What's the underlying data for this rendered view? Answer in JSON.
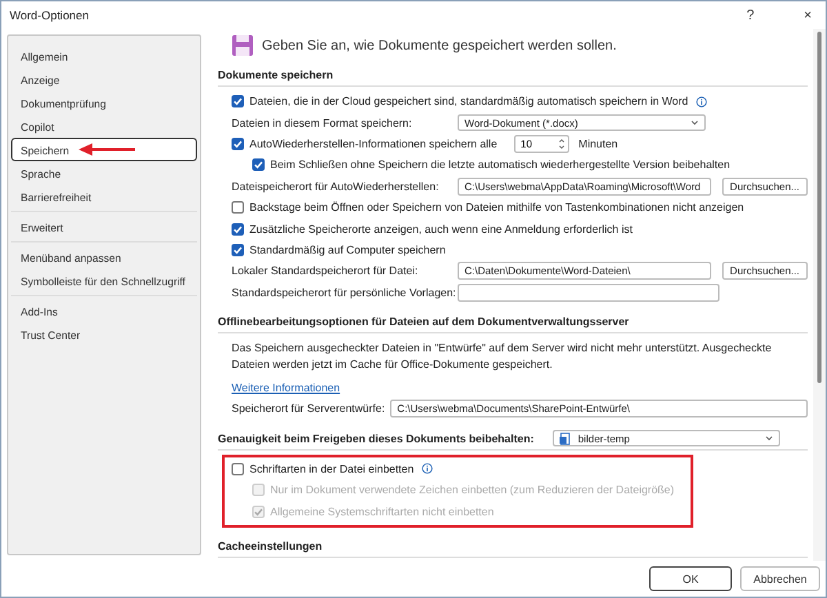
{
  "window": {
    "title": "Word-Optionen",
    "help": "?",
    "close": "×"
  },
  "sidebar": {
    "groups": [
      [
        {
          "label": "Allgemein",
          "selected": false,
          "annotated": false
        },
        {
          "label": "Anzeige",
          "selected": false,
          "annotated": false
        },
        {
          "label": "Dokumentprüfung",
          "selected": false,
          "annotated": false
        },
        {
          "label": "Copilot",
          "selected": false,
          "annotated": false
        },
        {
          "label": "Speichern",
          "selected": true,
          "annotated": true
        },
        {
          "label": "Sprache",
          "selected": false,
          "annotated": false
        },
        {
          "label": "Barrierefreiheit",
          "selected": false,
          "annotated": false
        }
      ],
      [
        {
          "label": "Erweitert",
          "selected": false,
          "annotated": false
        }
      ],
      [
        {
          "label": "Menüband anpassen",
          "selected": false,
          "annotated": false
        },
        {
          "label": "Symbolleiste für den Schnellzugriff",
          "selected": false,
          "annotated": false
        }
      ],
      [
        {
          "label": "Add-Ins",
          "selected": false,
          "annotated": false
        },
        {
          "label": "Trust Center",
          "selected": false,
          "annotated": false
        }
      ]
    ]
  },
  "content": {
    "banner": "Geben Sie an, wie Dokumente gespeichert werden sollen.",
    "sections": [
      {
        "heading": "Dokumente speichern",
        "rows": [
          {
            "kind": "checkbox",
            "label": "Dateien, die in der Cloud gespeichert sind, standardmäßig automatisch speichern in Word",
            "checked": true,
            "info": true
          },
          {
            "kind": "select",
            "label": "Dateien in diesem Format speichern:",
            "value": "Word-Dokument (*.docx)"
          },
          {
            "kind": "spin",
            "label": "AutoWiederherstellen-Informationen speichern alle",
            "checked": true,
            "value": "10",
            "unit": "Minuten",
            "children": [
              {
                "kind": "checkbox",
                "label": "Beim Schließen ohne Speichern die letzte automatisch wiederhergestellte Version beibehalten",
                "checked": true
              }
            ]
          },
          {
            "kind": "path",
            "label": "Dateispeicherort für AutoWiederherstellen:",
            "value": "C:\\Users\\webma\\AppData\\Roaming\\Microsoft\\Word",
            "button": "Durchsuchen..."
          },
          {
            "kind": "checkbox",
            "label": "Backstage beim Öffnen oder Speichern von Dateien mithilfe von Tastenkombinationen nicht anzeigen",
            "checked": false
          },
          {
            "kind": "checkbox",
            "label": "Zusätzliche Speicherorte anzeigen, auch wenn eine Anmeldung erforderlich ist",
            "checked": true
          },
          {
            "kind": "checkbox",
            "label": "Standardmäßig auf Computer speichern",
            "checked": true
          },
          {
            "kind": "path",
            "label": "Lokaler Standardspeicherort für Datei:",
            "value": "C:\\Daten\\Dokumente\\Word-Dateien\\",
            "button": "Durchsuchen..."
          },
          {
            "kind": "path",
            "label": "Standardspeicherort für persönliche Vorlagen:"
          }
        ]
      },
      {
        "heading": "Offlinebearbeitungsoptionen für Dateien auf dem Dokumentverwaltungsserver",
        "rows": [
          {
            "kind": "text",
            "label": "Das Speichern ausgecheckter Dateien in \"Entwürfe\" auf dem Server wird nicht mehr unterstützt. Ausgecheckte Dateien werden jetzt im Cache für Office-Dokumente gespeichert."
          },
          {
            "kind": "link",
            "label": "Weitere Informationen"
          },
          {
            "kind": "wide_path",
            "label": "Speicherort für Serverentwürfe:",
            "value": "C:\\Users\\webma\\Documents\\SharePoint-Entwürfe\\"
          }
        ]
      },
      {
        "heading": "Genauigkeit beim Freigeben dieses Dokuments beibehalten:",
        "heading_select": "bilder-temp",
        "rows": [
          {
            "kind": "checkbox",
            "label": "Schriftarten in der Datei einbetten",
            "checked": false,
            "info": true,
            "highlighted": true,
            "children": [
              {
                "kind": "checkbox",
                "label": "Nur im Dokument verwendete Zeichen einbetten (zum Reduzieren der Dateigröße)",
                "checked": false,
                "disabled": true
              },
              {
                "kind": "checkbox",
                "label": "Allgemeine Systemschriftarten nicht einbetten",
                "checked": true,
                "disabled": true
              }
            ]
          }
        ]
      },
      {
        "heading": "Cacheeinstellungen"
      }
    ]
  },
  "buttons": [
    {
      "label": "OK",
      "default": true
    },
    {
      "label": "Abbrechen",
      "default": false
    }
  ]
}
